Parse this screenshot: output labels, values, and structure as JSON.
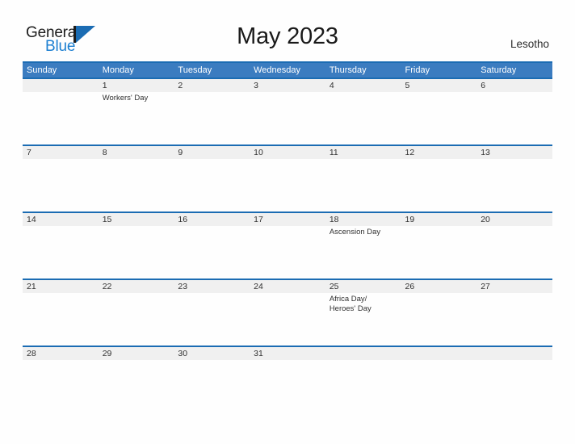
{
  "brand": {
    "word_one": "General",
    "word_two": "Blue",
    "logo_icon": "triangle-flag-logo",
    "accent_color": "#1b6cb3",
    "header_color": "#3b7cc0"
  },
  "header": {
    "title": "May 2023",
    "country": "Lesotho"
  },
  "calendar": {
    "weekday_headers": [
      "Sunday",
      "Monday",
      "Tuesday",
      "Wednesday",
      "Thursday",
      "Friday",
      "Saturday"
    ],
    "weeks": [
      {
        "days": [
          {
            "date": "",
            "event": ""
          },
          {
            "date": "1",
            "event": "Workers' Day"
          },
          {
            "date": "2",
            "event": ""
          },
          {
            "date": "3",
            "event": ""
          },
          {
            "date": "4",
            "event": ""
          },
          {
            "date": "5",
            "event": ""
          },
          {
            "date": "6",
            "event": ""
          }
        ]
      },
      {
        "days": [
          {
            "date": "7",
            "event": ""
          },
          {
            "date": "8",
            "event": ""
          },
          {
            "date": "9",
            "event": ""
          },
          {
            "date": "10",
            "event": ""
          },
          {
            "date": "11",
            "event": ""
          },
          {
            "date": "12",
            "event": ""
          },
          {
            "date": "13",
            "event": ""
          }
        ]
      },
      {
        "days": [
          {
            "date": "14",
            "event": ""
          },
          {
            "date": "15",
            "event": ""
          },
          {
            "date": "16",
            "event": ""
          },
          {
            "date": "17",
            "event": ""
          },
          {
            "date": "18",
            "event": "Ascension Day"
          },
          {
            "date": "19",
            "event": ""
          },
          {
            "date": "20",
            "event": ""
          }
        ]
      },
      {
        "days": [
          {
            "date": "21",
            "event": ""
          },
          {
            "date": "22",
            "event": ""
          },
          {
            "date": "23",
            "event": ""
          },
          {
            "date": "24",
            "event": ""
          },
          {
            "date": "25",
            "event": "Africa Day/ Heroes' Day"
          },
          {
            "date": "26",
            "event": ""
          },
          {
            "date": "27",
            "event": ""
          }
        ]
      },
      {
        "days": [
          {
            "date": "28",
            "event": ""
          },
          {
            "date": "29",
            "event": ""
          },
          {
            "date": "30",
            "event": ""
          },
          {
            "date": "31",
            "event": ""
          },
          {
            "date": "",
            "event": ""
          },
          {
            "date": "",
            "event": ""
          },
          {
            "date": "",
            "event": ""
          }
        ]
      }
    ]
  }
}
